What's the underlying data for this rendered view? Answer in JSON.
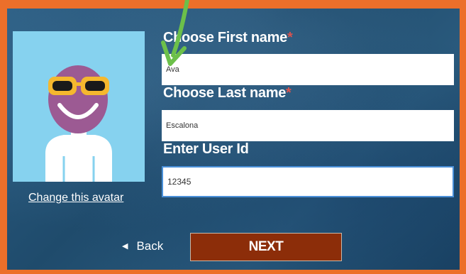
{
  "form": {
    "first_name_label": "Choose First name",
    "first_name_value": "Ava",
    "last_name_label": "Choose Last name",
    "last_name_value": "Escalona",
    "user_id_label": "Enter User Id",
    "user_id_value": "12345",
    "required_marker": "*"
  },
  "avatar": {
    "change_link": "Change this avatar"
  },
  "nav": {
    "back_label": "Back",
    "next_label": "NEXT"
  },
  "colors": {
    "outer_border": "#ec6f2a",
    "next_button": "#8c2d09",
    "avatar_background": "#86d2ef",
    "annotation_arrow": "#6cc04a"
  },
  "icons": {
    "back": "triangle-left-icon",
    "annotation": "green-arrow-icon"
  }
}
